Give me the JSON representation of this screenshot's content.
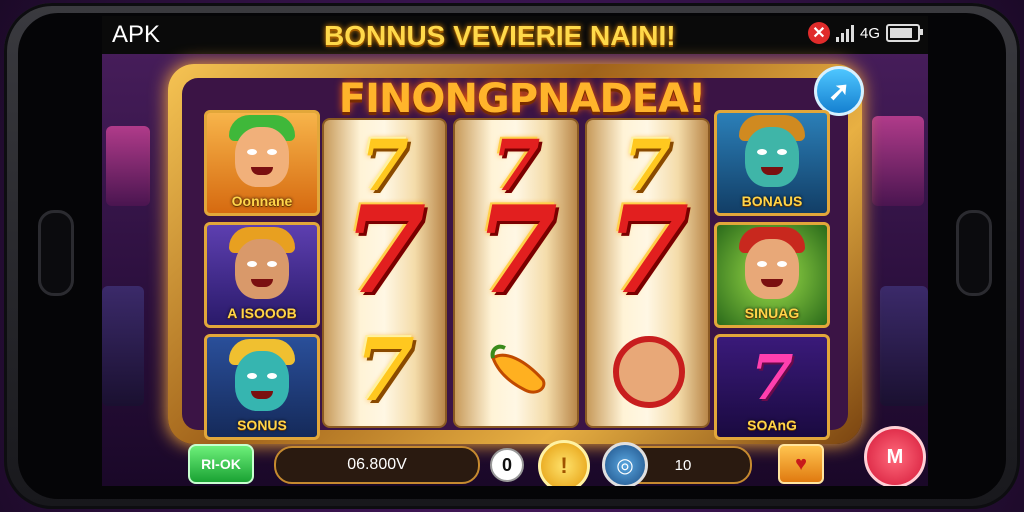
{
  "status_bar": {
    "apk_label": "APK",
    "network_label": "4G",
    "battery_level": 0.85
  },
  "banner": {
    "text": "BONNUS VEVIERIE NAINI!"
  },
  "game": {
    "title": "FINONGPNADEA!",
    "share_icon": "share-arrow-icon",
    "left_cards": [
      {
        "label": "Oonnane"
      },
      {
        "label": "A ISOOOB"
      },
      {
        "label": "SONUS"
      }
    ],
    "right_cards": [
      {
        "label": "BONAUS"
      },
      {
        "label": "SINUAG"
      },
      {
        "label": "SOAnG"
      }
    ],
    "reels": [
      {
        "symbols": [
          "7",
          "7",
          "7"
        ]
      },
      {
        "symbols": [
          "7",
          "7",
          "pepper"
        ]
      },
      {
        "symbols": [
          "7",
          "7",
          "face"
        ]
      }
    ]
  },
  "controls": {
    "spin_label": "RI-OK",
    "credit_value": "06.800V",
    "zero_label": "0",
    "coin_label": "!",
    "bet_value": "10",
    "max_label": "M"
  },
  "colors": {
    "frame_gold": "#e8b043",
    "seven_red": "#e21f1f",
    "seven_gold": "#ffc81f",
    "spin_green": "#1aa233",
    "max_red": "#d41838",
    "share_blue": "#1580d0"
  }
}
